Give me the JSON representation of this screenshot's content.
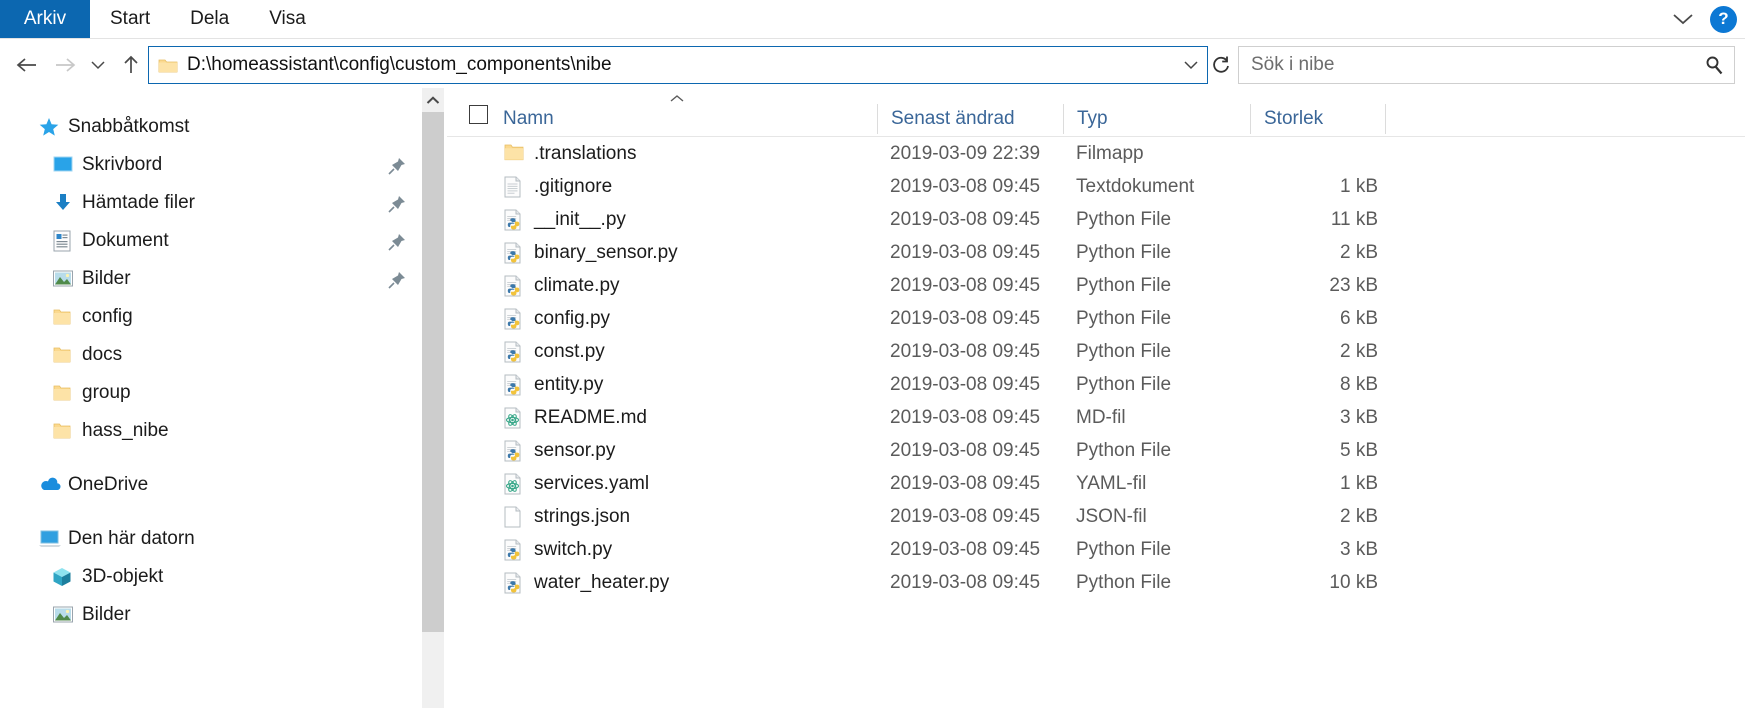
{
  "ribbon": {
    "tabs": [
      {
        "label": "Arkiv",
        "active": true
      },
      {
        "label": "Start",
        "active": false
      },
      {
        "label": "Dela",
        "active": false
      },
      {
        "label": "Visa",
        "active": false
      }
    ],
    "expand_icon": "chevron-down-icon",
    "help_label": "?"
  },
  "nav": {
    "back_icon": "arrow-left-icon",
    "forward_icon": "arrow-right-icon",
    "recent_icon": "chevron-down-icon",
    "up_icon": "arrow-up-icon",
    "address_value": "D:\\homeassistant\\config\\custom_components\\nibe",
    "address_dropdown_icon": "chevron-down-icon",
    "refresh_icon": "refresh-icon"
  },
  "search": {
    "placeholder": "Sök i nibe",
    "value": "",
    "icon": "search-icon"
  },
  "sidebar": {
    "items": [
      {
        "label": "Snabbåtkomst",
        "icon": "star-icon",
        "indent": 0,
        "pinned": false
      },
      {
        "label": "Skrivbord",
        "icon": "desktop-icon",
        "indent": 1,
        "pinned": true
      },
      {
        "label": "Hämtade filer",
        "icon": "download-icon",
        "indent": 1,
        "pinned": true
      },
      {
        "label": "Dokument",
        "icon": "document-icon",
        "indent": 1,
        "pinned": true
      },
      {
        "label": "Bilder",
        "icon": "pictures-icon",
        "indent": 1,
        "pinned": true
      },
      {
        "label": "config",
        "icon": "folder-icon",
        "indent": 1,
        "pinned": false
      },
      {
        "label": "docs",
        "icon": "folder-icon",
        "indent": 1,
        "pinned": false
      },
      {
        "label": "group",
        "icon": "folder-icon",
        "indent": 1,
        "pinned": false
      },
      {
        "label": "hass_nibe",
        "icon": "folder-icon",
        "indent": 1,
        "pinned": false
      },
      {
        "label": "OneDrive",
        "icon": "onedrive-icon",
        "indent": 0,
        "pinned": false,
        "gap_before": true
      },
      {
        "label": "Den här datorn",
        "icon": "this-pc-icon",
        "indent": 0,
        "pinned": false,
        "gap_before": true
      },
      {
        "label": "3D-objekt",
        "icon": "3d-objects-icon",
        "indent": 1,
        "pinned": false
      },
      {
        "label": "Bilder",
        "icon": "pictures-icon",
        "indent": 1,
        "pinned": false
      }
    ]
  },
  "file_list": {
    "select_all_checkbox": false,
    "sort_indicator": "ascending-caret-icon",
    "columns": [
      {
        "key": "name",
        "label": "Namn"
      },
      {
        "key": "modified",
        "label": "Senast ändrad"
      },
      {
        "key": "type",
        "label": "Typ"
      },
      {
        "key": "size",
        "label": "Storlek"
      }
    ],
    "rows": [
      {
        "name": ".translations",
        "modified": "2019-03-09 22:39",
        "type": "Filmapp",
        "size": "",
        "icon": "folder-icon"
      },
      {
        "name": ".gitignore",
        "modified": "2019-03-08 09:45",
        "type": "Textdokument",
        "size": "1 kB",
        "icon": "text-file-icon"
      },
      {
        "name": "__init__.py",
        "modified": "2019-03-08 09:45",
        "type": "Python File",
        "size": "11 kB",
        "icon": "python-file-icon"
      },
      {
        "name": "binary_sensor.py",
        "modified": "2019-03-08 09:45",
        "type": "Python File",
        "size": "2 kB",
        "icon": "python-file-icon"
      },
      {
        "name": "climate.py",
        "modified": "2019-03-08 09:45",
        "type": "Python File",
        "size": "23 kB",
        "icon": "python-file-icon"
      },
      {
        "name": "config.py",
        "modified": "2019-03-08 09:45",
        "type": "Python File",
        "size": "6 kB",
        "icon": "python-file-icon"
      },
      {
        "name": "const.py",
        "modified": "2019-03-08 09:45",
        "type": "Python File",
        "size": "2 kB",
        "icon": "python-file-icon"
      },
      {
        "name": "entity.py",
        "modified": "2019-03-08 09:45",
        "type": "Python File",
        "size": "8 kB",
        "icon": "python-file-icon"
      },
      {
        "name": "README.md",
        "modified": "2019-03-08 09:45",
        "type": "MD-fil",
        "size": "3 kB",
        "icon": "atom-file-icon"
      },
      {
        "name": "sensor.py",
        "modified": "2019-03-08 09:45",
        "type": "Python File",
        "size": "5 kB",
        "icon": "python-file-icon"
      },
      {
        "name": "services.yaml",
        "modified": "2019-03-08 09:45",
        "type": "YAML-fil",
        "size": "1 kB",
        "icon": "atom-file-icon"
      },
      {
        "name": "strings.json",
        "modified": "2019-03-08 09:45",
        "type": "JSON-fil",
        "size": "2 kB",
        "icon": "blank-file-icon"
      },
      {
        "name": "switch.py",
        "modified": "2019-03-08 09:45",
        "type": "Python File",
        "size": "3 kB",
        "icon": "python-file-icon"
      },
      {
        "name": "water_heater.py",
        "modified": "2019-03-08 09:45",
        "type": "Python File",
        "size": "10 kB",
        "icon": "python-file-icon"
      }
    ]
  },
  "colors": {
    "accent": "#0c67b0",
    "header_text": "#3a6698",
    "folder": "#fcd77a",
    "help_blue": "#0c78d4"
  }
}
